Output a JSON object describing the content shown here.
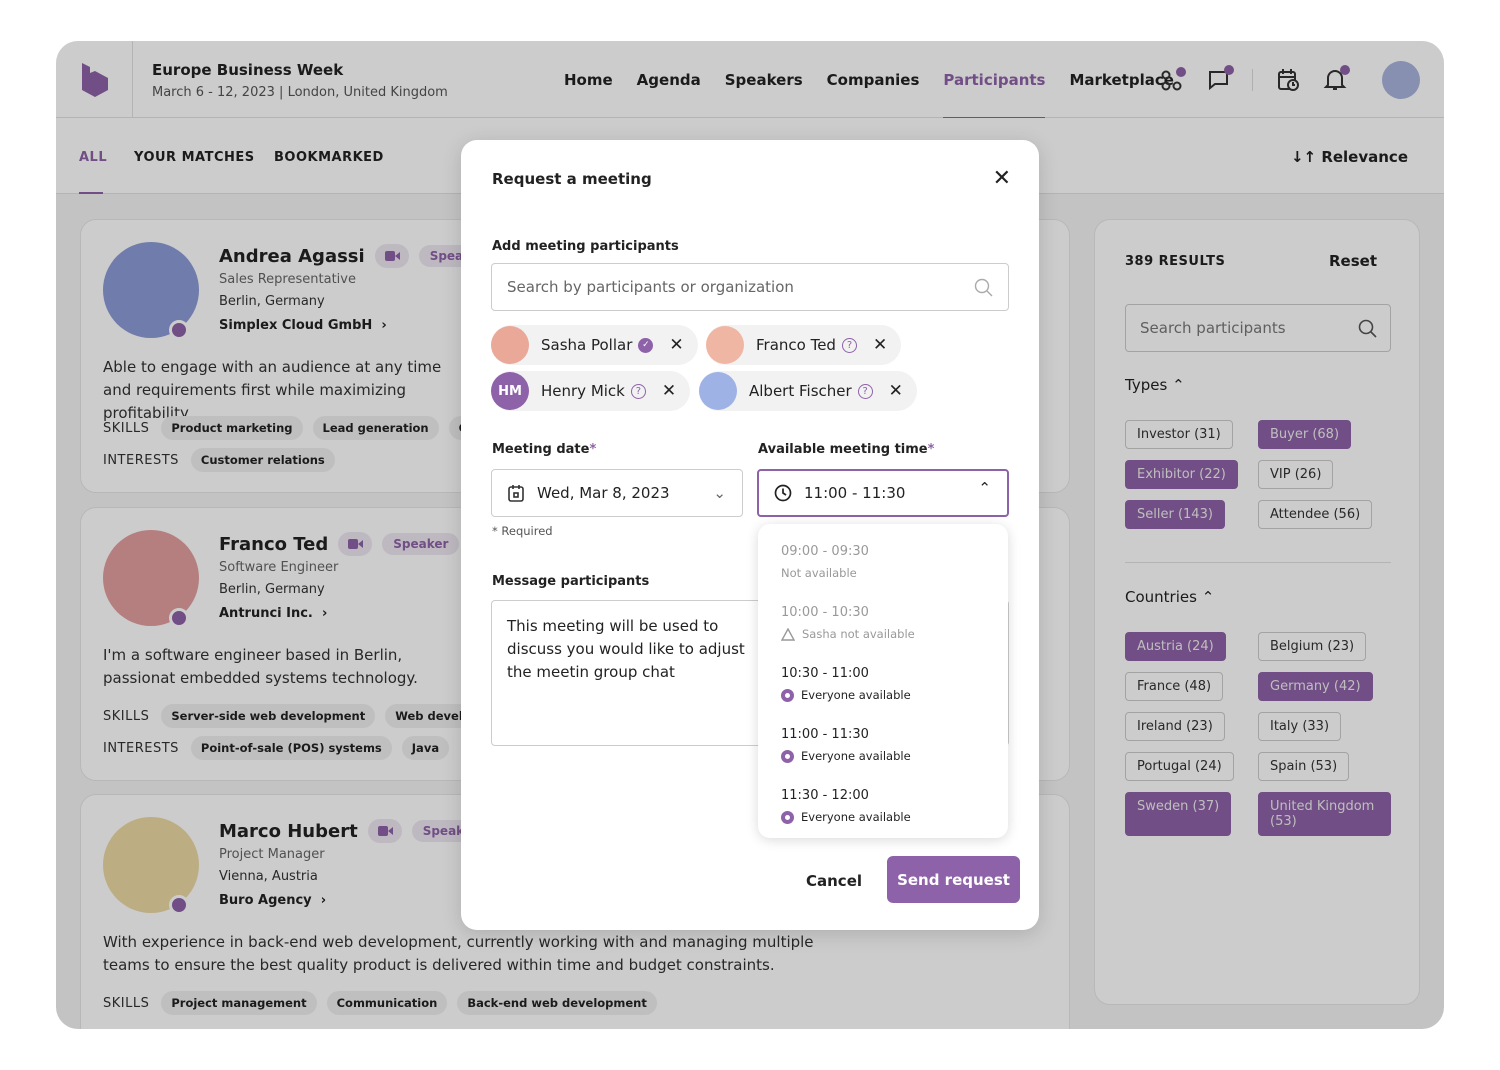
{
  "header": {
    "event_title": "Europe Business Week",
    "event_dates": "March 6 - 12, 2023",
    "event_location": "London, United Kingdom",
    "separator": "|",
    "nav": [
      "Home",
      "Agenda",
      "Speakers",
      "Companies",
      "Participants",
      "Marketplace"
    ],
    "active_nav": "Participants"
  },
  "tabs": [
    "ALL",
    "YOUR MATCHES",
    "BOOKMARKED"
  ],
  "sort": {
    "label": "Relevance"
  },
  "accent": "#8e62a8",
  "participants": [
    {
      "name": "Andrea Agassi",
      "badge": "Speaker",
      "role": "Sales Representative",
      "location": "Berlin, Germany",
      "company": "Simplex Cloud GmbH",
      "bio": "Able to engage with an audience at any time and requirements first while maximizing profitability.",
      "skills": [
        "Product marketing",
        "Lead generation",
        "Contra"
      ],
      "interests": [
        "Customer relations"
      ],
      "avatar_color": "#8d9cd6"
    },
    {
      "name": "Franco Ted",
      "badge": "Speaker",
      "role": "Software Engineer",
      "location": "Berlin, Germany",
      "company": "Antrunci Inc.",
      "bio": "I'm a software engineer based in Berlin, passionat embedded systems technology.",
      "skills": [
        "Server-side web development",
        "Web development"
      ],
      "interests": [
        "Point-of-sale (POS) systems",
        "Java"
      ],
      "avatar_color": "#e39f9f"
    },
    {
      "name": "Marco Hubert",
      "badge": "Speaker",
      "role": "Project Manager",
      "location": "Vienna, Austria",
      "company": "Buro Agency",
      "bio": "With experience in back-end web development, currently working with and managing multiple teams to ensure the best quality product is delivered within time and budget constraints.",
      "skills": [
        "Project management",
        "Communication",
        "Back-end web development"
      ],
      "interests": [],
      "avatar_color": "#ecd9a4"
    }
  ],
  "labels": {
    "skills": "SKILLS",
    "interests": "INTERESTS"
  },
  "filters": {
    "results": "389 RESULTS",
    "reset": "Reset",
    "search_placeholder": "Search participants",
    "types_label": "Types",
    "types": [
      {
        "label": "Investor (31)",
        "on": false
      },
      {
        "label": "Buyer (68)",
        "on": true
      },
      {
        "label": "Exhibitor (22)",
        "on": true
      },
      {
        "label": "VIP (26)",
        "on": false
      },
      {
        "label": "Seller (143)",
        "on": true
      },
      {
        "label": "Attendee (56)",
        "on": false
      }
    ],
    "countries_label": "Countries",
    "countries": [
      {
        "label": "Austria (24)",
        "on": true
      },
      {
        "label": "Belgium (23)",
        "on": false
      },
      {
        "label": "France (48)",
        "on": false
      },
      {
        "label": "Germany (42)",
        "on": true
      },
      {
        "label": "Ireland (23)",
        "on": false
      },
      {
        "label": "Italy (33)",
        "on": false
      },
      {
        "label": "Portugal (24)",
        "on": false
      },
      {
        "label": "Spain (53)",
        "on": false
      },
      {
        "label": "Sweden (37)",
        "on": true
      },
      {
        "label": "United Kingdom (53)",
        "on": true
      }
    ]
  },
  "modal": {
    "title": "Request a meeting",
    "participants_label": "Add meeting participants",
    "search_placeholder": "Search by participants or organization",
    "invitees": [
      {
        "name": "Sasha Pollar",
        "status": "confirmed",
        "avatar_color": "#e9a898"
      },
      {
        "name": "Franco Ted",
        "status": "pending",
        "avatar_color": "#f0b6a4"
      },
      {
        "name": "Henry Mick",
        "initials": "HM",
        "status": "pending",
        "avatar_color": "#8e62a8"
      },
      {
        "name": "Albert Fischer",
        "status": "pending",
        "avatar_color": "#9fb2e6"
      }
    ],
    "date_label": "Meeting date",
    "date_value": "Wed, Mar 8, 2023",
    "time_label": "Available meeting time",
    "time_value": "11:00 - 11:30",
    "required_star": "*",
    "required_note": "* Required",
    "message_label": "Message participants",
    "message_value": "This meeting will be used to discuss you would like to adjust the meetin group chat",
    "time_options": [
      {
        "time": "09:00 - 09:30",
        "status": "Not available",
        "state": "unavailable"
      },
      {
        "time": "10:00 - 10:30",
        "status": "Sasha not available",
        "state": "partial"
      },
      {
        "time": "10:30 - 11:00",
        "status": "Everyone available",
        "state": "available"
      },
      {
        "time": "11:00 - 11:30",
        "status": "Everyone available",
        "state": "available"
      },
      {
        "time": "11:30 - 12:00",
        "status": "Everyone available",
        "state": "available"
      }
    ],
    "cancel": "Cancel",
    "send": "Send request"
  }
}
